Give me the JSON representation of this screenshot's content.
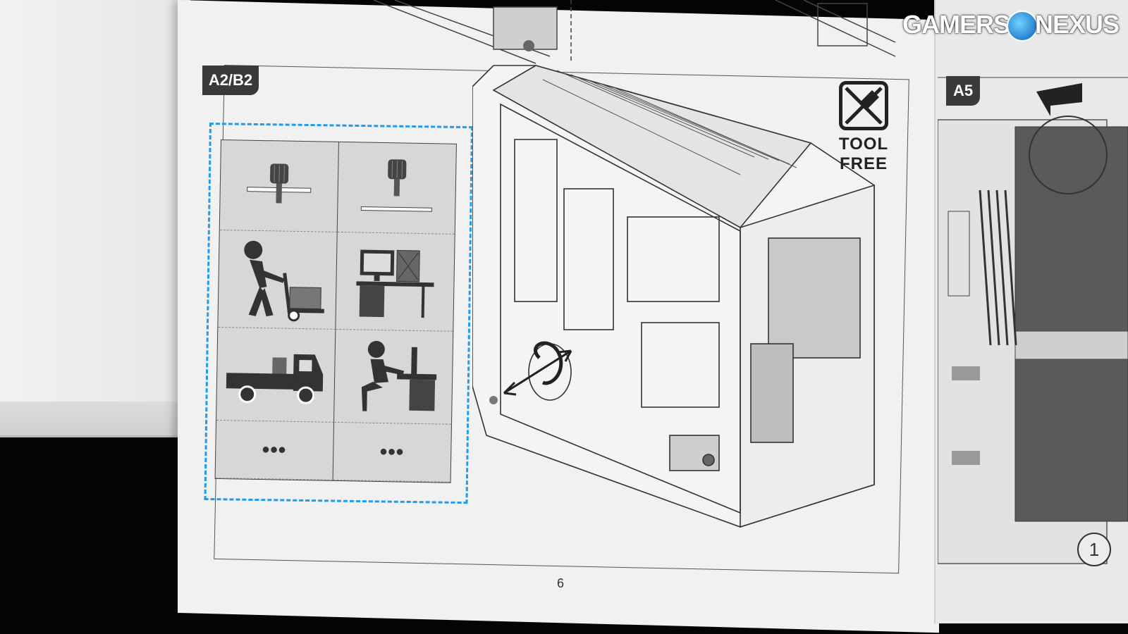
{
  "manual": {
    "section_left": "A2/B2",
    "section_right": "A5",
    "tool_free_line1": "TOOL",
    "tool_free_line2": "FREE",
    "page_number": "6",
    "step_number": "1",
    "grid_more_left": "•••",
    "grid_more_right": "•••"
  },
  "watermark": {
    "left": "GAMERS",
    "right": "NEXUS"
  },
  "colors": {
    "dashed_border": "#1f9bef",
    "label_bg": "#3a3a3a"
  }
}
